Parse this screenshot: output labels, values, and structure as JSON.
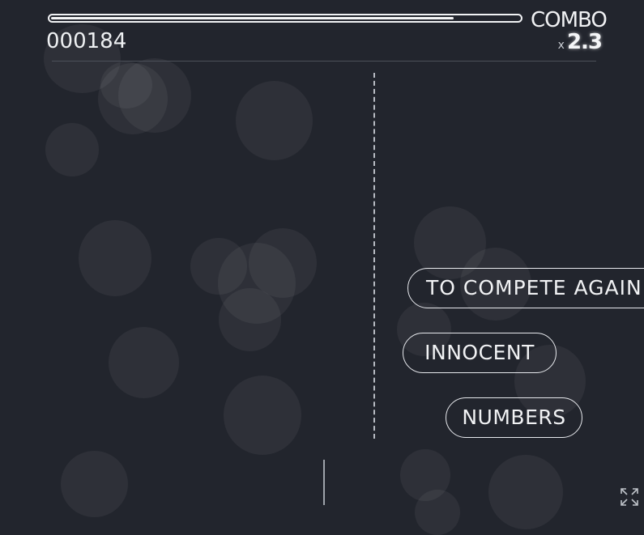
{
  "hud": {
    "combo_label": "COMBO",
    "multiplier_prefix": "x",
    "multiplier_value": "2.3",
    "score": "000184",
    "combo_progress": 0.86
  },
  "words": [
    {
      "label": "TO COMPETE AGAIN"
    },
    {
      "label": "INNOCENT"
    },
    {
      "label": "NUMBERS"
    }
  ],
  "colors": {
    "background": "#22252d",
    "text": "#f1f2f4",
    "bubble": "rgba(255,255,255,0.055)"
  },
  "icons": {
    "fullscreen": "fullscreen-icon"
  }
}
